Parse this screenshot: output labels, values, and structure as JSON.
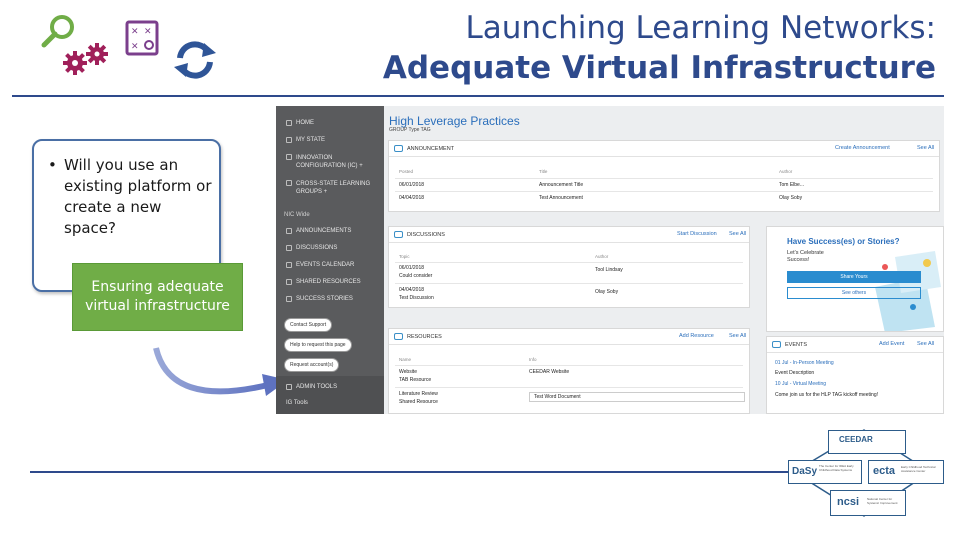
{
  "slide": {
    "title_line1": "Launching Learning Networks:",
    "title_line2": "Adequate Virtual Infrastructure",
    "colors": {
      "title": "#2e4a8c",
      "green": "#70ad47",
      "magenta": "#a0205a",
      "blue": "#2f5597"
    }
  },
  "icons": [
    "search-icon",
    "gears-icon",
    "strategy-board-icon",
    "refresh-icon"
  ],
  "callout": {
    "bullet": "•",
    "question": "Will you use an existing platform or create a new space?",
    "box_text": "Ensuring adequate virtual infrastructure"
  },
  "screenshot": {
    "nav": {
      "items": [
        {
          "label": "HOME",
          "icon": "home-icon"
        },
        {
          "label": "MY STATE",
          "icon": "flag-icon"
        },
        {
          "label": "INNOVATION CONFIGURATION (IC) +",
          "icon": "lightning-icon"
        },
        {
          "label": "CROSS-STATE LEARNING GROUPS +",
          "icon": "share-icon"
        }
      ],
      "section_label": "NIC Wide",
      "section_items": [
        {
          "label": "ANNOUNCEMENTS",
          "icon": "megaphone-icon"
        },
        {
          "label": "DISCUSSIONS",
          "icon": "chat-icon"
        },
        {
          "label": "EVENTS CALENDAR",
          "icon": "calendar-icon"
        },
        {
          "label": "SHARED RESOURCES",
          "icon": "folder-icon"
        },
        {
          "label": "SUCCESS STORIES",
          "icon": "star-icon"
        }
      ],
      "buttons": [
        "Contact Support",
        "Help to request this page",
        "Request account(s)"
      ],
      "admin_tools": "ADMIN TOOLS",
      "ig_tools": "IG Tools"
    },
    "page_title": "High Leverage Practices",
    "group_type": "GROUP Type TAG",
    "announcements": {
      "heading": "ANNOUNCEMENT",
      "action": "Create Announcement",
      "see_all": "See All",
      "columns": [
        "Posted",
        "Title",
        "Author"
      ],
      "rows": [
        {
          "posted": "06/01/2018",
          "title": "Announcement Title",
          "author": "Tom Elbe..."
        },
        {
          "posted": "04/04/2018",
          "title": "Test Announcement",
          "author": "Olay Soby"
        }
      ]
    },
    "discussions": {
      "heading": "DISCUSSIONS",
      "action": "Start Discussion",
      "see_all": "See All",
      "columns": [
        "Topic",
        "Author"
      ],
      "rows": [
        {
          "topic": "06/01/2018",
          "topic2": "Could consider",
          "author": "Tool Lindsay"
        },
        {
          "topic": "04/04/2018",
          "topic2": "Test Discussion",
          "author": "Olay Soby"
        }
      ]
    },
    "resources": {
      "heading": "RESOURCES",
      "action": "Add Resource",
      "see_all": "See All",
      "columns": [
        "Name",
        "Info"
      ],
      "rows": [
        {
          "name": "Website",
          "name2": "TAB Resource",
          "info": "CEEDAR Website"
        },
        {
          "name": "Literature Review",
          "name2": "Shared Resource",
          "info": "Test Word Document"
        }
      ]
    },
    "promo": {
      "title": "Have Success(es) or Stories?",
      "subtitle": "Let's Celebrate Success!",
      "button1": "Share Yours",
      "button2": "See others"
    },
    "events": {
      "heading": "EVENTS",
      "action": "Add Event",
      "see_all": "See All",
      "items": [
        "01 Jul - In-Person Meeting",
        "Event Description",
        "10 Jul - Virtual Meeting",
        "Come join us for the HLP TAG kickoff meeting!"
      ]
    }
  },
  "logos": {
    "top": "CEEDAR",
    "left": "DaSy",
    "left_sub": "The Center for IDEA Early Childhood Data Systems",
    "right": "ecta",
    "right_sub": "Early Childhood Technical Assistance Center",
    "bottom": "ncsi",
    "bottom_sub": "National Center for Systemic Improvement"
  }
}
